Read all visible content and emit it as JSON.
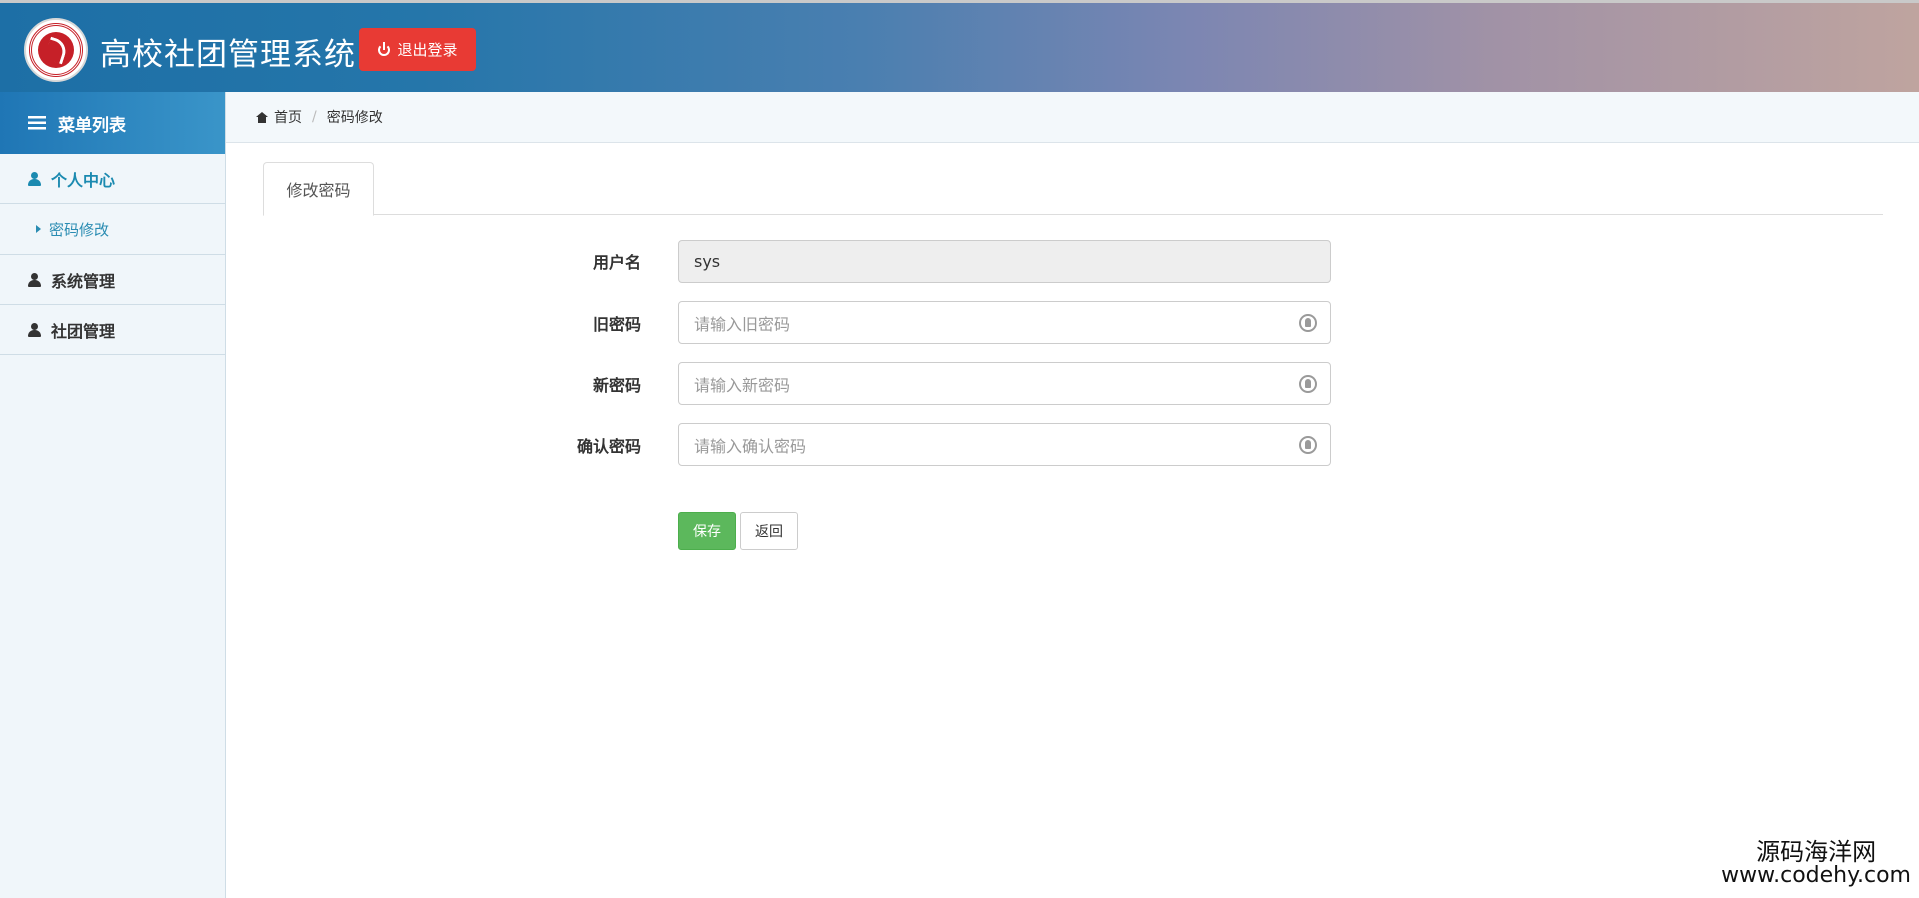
{
  "header": {
    "app_title": "高校社团管理系统",
    "logout_label": "退出登录",
    "logo_icon": "school-emblem-icon"
  },
  "sidebar": {
    "title": "菜单列表",
    "items": [
      {
        "label": "个人中心",
        "icon": "user-icon",
        "active": true,
        "children": [
          {
            "label": "密码修改",
            "icon": "caret-right-icon"
          }
        ]
      },
      {
        "label": "系统管理",
        "icon": "user-icon",
        "active": false
      },
      {
        "label": "社团管理",
        "icon": "user-icon",
        "active": false
      }
    ]
  },
  "breadcrumb": {
    "home": "首页",
    "separator": "/",
    "current": "密码修改"
  },
  "tabs": [
    {
      "label": "修改密码",
      "active": true
    }
  ],
  "form": {
    "username": {
      "label": "用户名",
      "value": "sys"
    },
    "old_password": {
      "label": "旧密码",
      "placeholder": "请输入旧密码"
    },
    "new_password": {
      "label": "新密码",
      "placeholder": "请输入新密码"
    },
    "confirm_password": {
      "label": "确认密码",
      "placeholder": "请输入确认密码"
    },
    "save_label": "保存",
    "back_label": "返回"
  },
  "watermark": {
    "line1": "源码海洋网",
    "line2": "www.codehy.com"
  },
  "colors": {
    "header_start": "#1d6fa6",
    "header_end": "#bfa49f",
    "logout": "#e83a34",
    "accent": "#1b8ab0",
    "save": "#5cb85c",
    "sidebar_bg": "#f0f6fa"
  }
}
